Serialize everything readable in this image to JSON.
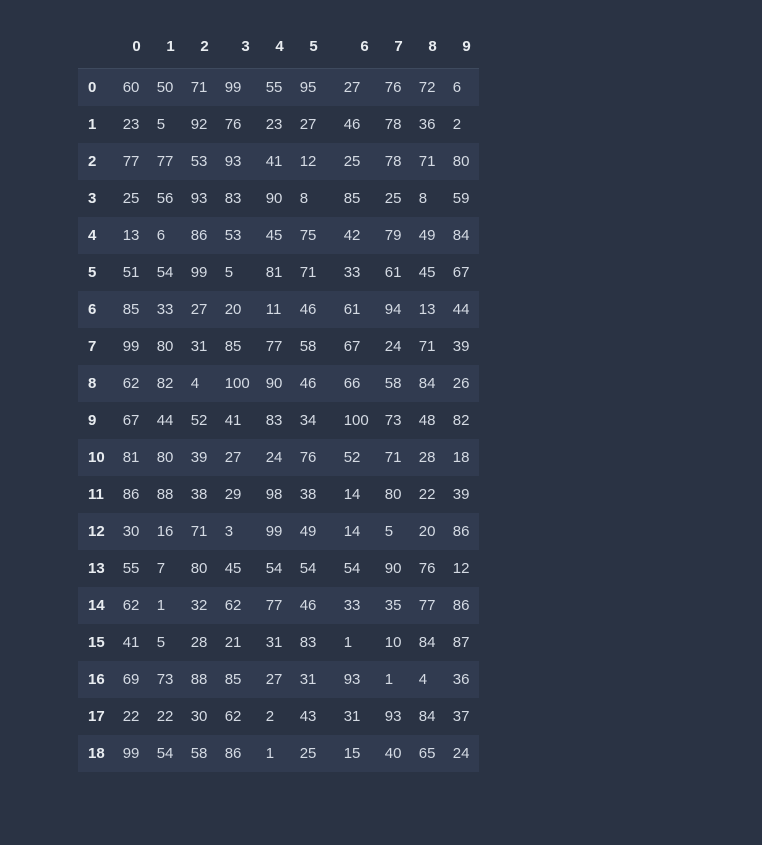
{
  "chart_data": {
    "type": "table",
    "title": "",
    "columns": [
      "0",
      "1",
      "2",
      "3",
      "4",
      "5",
      "6",
      "7",
      "8",
      "9"
    ],
    "index": [
      "0",
      "1",
      "2",
      "3",
      "4",
      "5",
      "6",
      "7",
      "8",
      "9",
      "10",
      "11",
      "12",
      "13",
      "14",
      "15",
      "16",
      "17",
      "18"
    ],
    "values": [
      [
        60,
        50,
        71,
        99,
        55,
        95,
        27,
        76,
        72,
        6
      ],
      [
        23,
        5,
        92,
        76,
        23,
        27,
        46,
        78,
        36,
        2
      ],
      [
        77,
        77,
        53,
        93,
        41,
        12,
        25,
        78,
        71,
        80
      ],
      [
        25,
        56,
        93,
        83,
        90,
        8,
        85,
        25,
        8,
        59
      ],
      [
        13,
        6,
        86,
        53,
        45,
        75,
        42,
        79,
        49,
        84
      ],
      [
        51,
        54,
        99,
        5,
        81,
        71,
        33,
        61,
        45,
        67
      ],
      [
        85,
        33,
        27,
        20,
        11,
        46,
        61,
        94,
        13,
        44
      ],
      [
        99,
        80,
        31,
        85,
        77,
        58,
        67,
        24,
        71,
        39
      ],
      [
        62,
        82,
        4,
        100,
        90,
        46,
        66,
        58,
        84,
        26
      ],
      [
        67,
        44,
        52,
        41,
        83,
        34,
        100,
        73,
        48,
        82
      ],
      [
        81,
        80,
        39,
        27,
        24,
        76,
        52,
        71,
        28,
        18
      ],
      [
        86,
        88,
        38,
        29,
        98,
        38,
        14,
        80,
        22,
        39
      ],
      [
        30,
        16,
        71,
        3,
        99,
        49,
        14,
        5,
        20,
        86
      ],
      [
        55,
        7,
        80,
        45,
        54,
        54,
        54,
        90,
        76,
        12
      ],
      [
        62,
        1,
        32,
        62,
        77,
        46,
        33,
        35,
        77,
        86
      ],
      [
        41,
        5,
        28,
        21,
        31,
        83,
        1,
        10,
        84,
        87
      ],
      [
        69,
        73,
        88,
        85,
        27,
        31,
        93,
        1,
        4,
        36
      ],
      [
        22,
        22,
        30,
        62,
        2,
        43,
        31,
        93,
        84,
        37
      ],
      [
        99,
        54,
        58,
        86,
        1,
        25,
        15,
        40,
        65,
        24
      ]
    ]
  }
}
